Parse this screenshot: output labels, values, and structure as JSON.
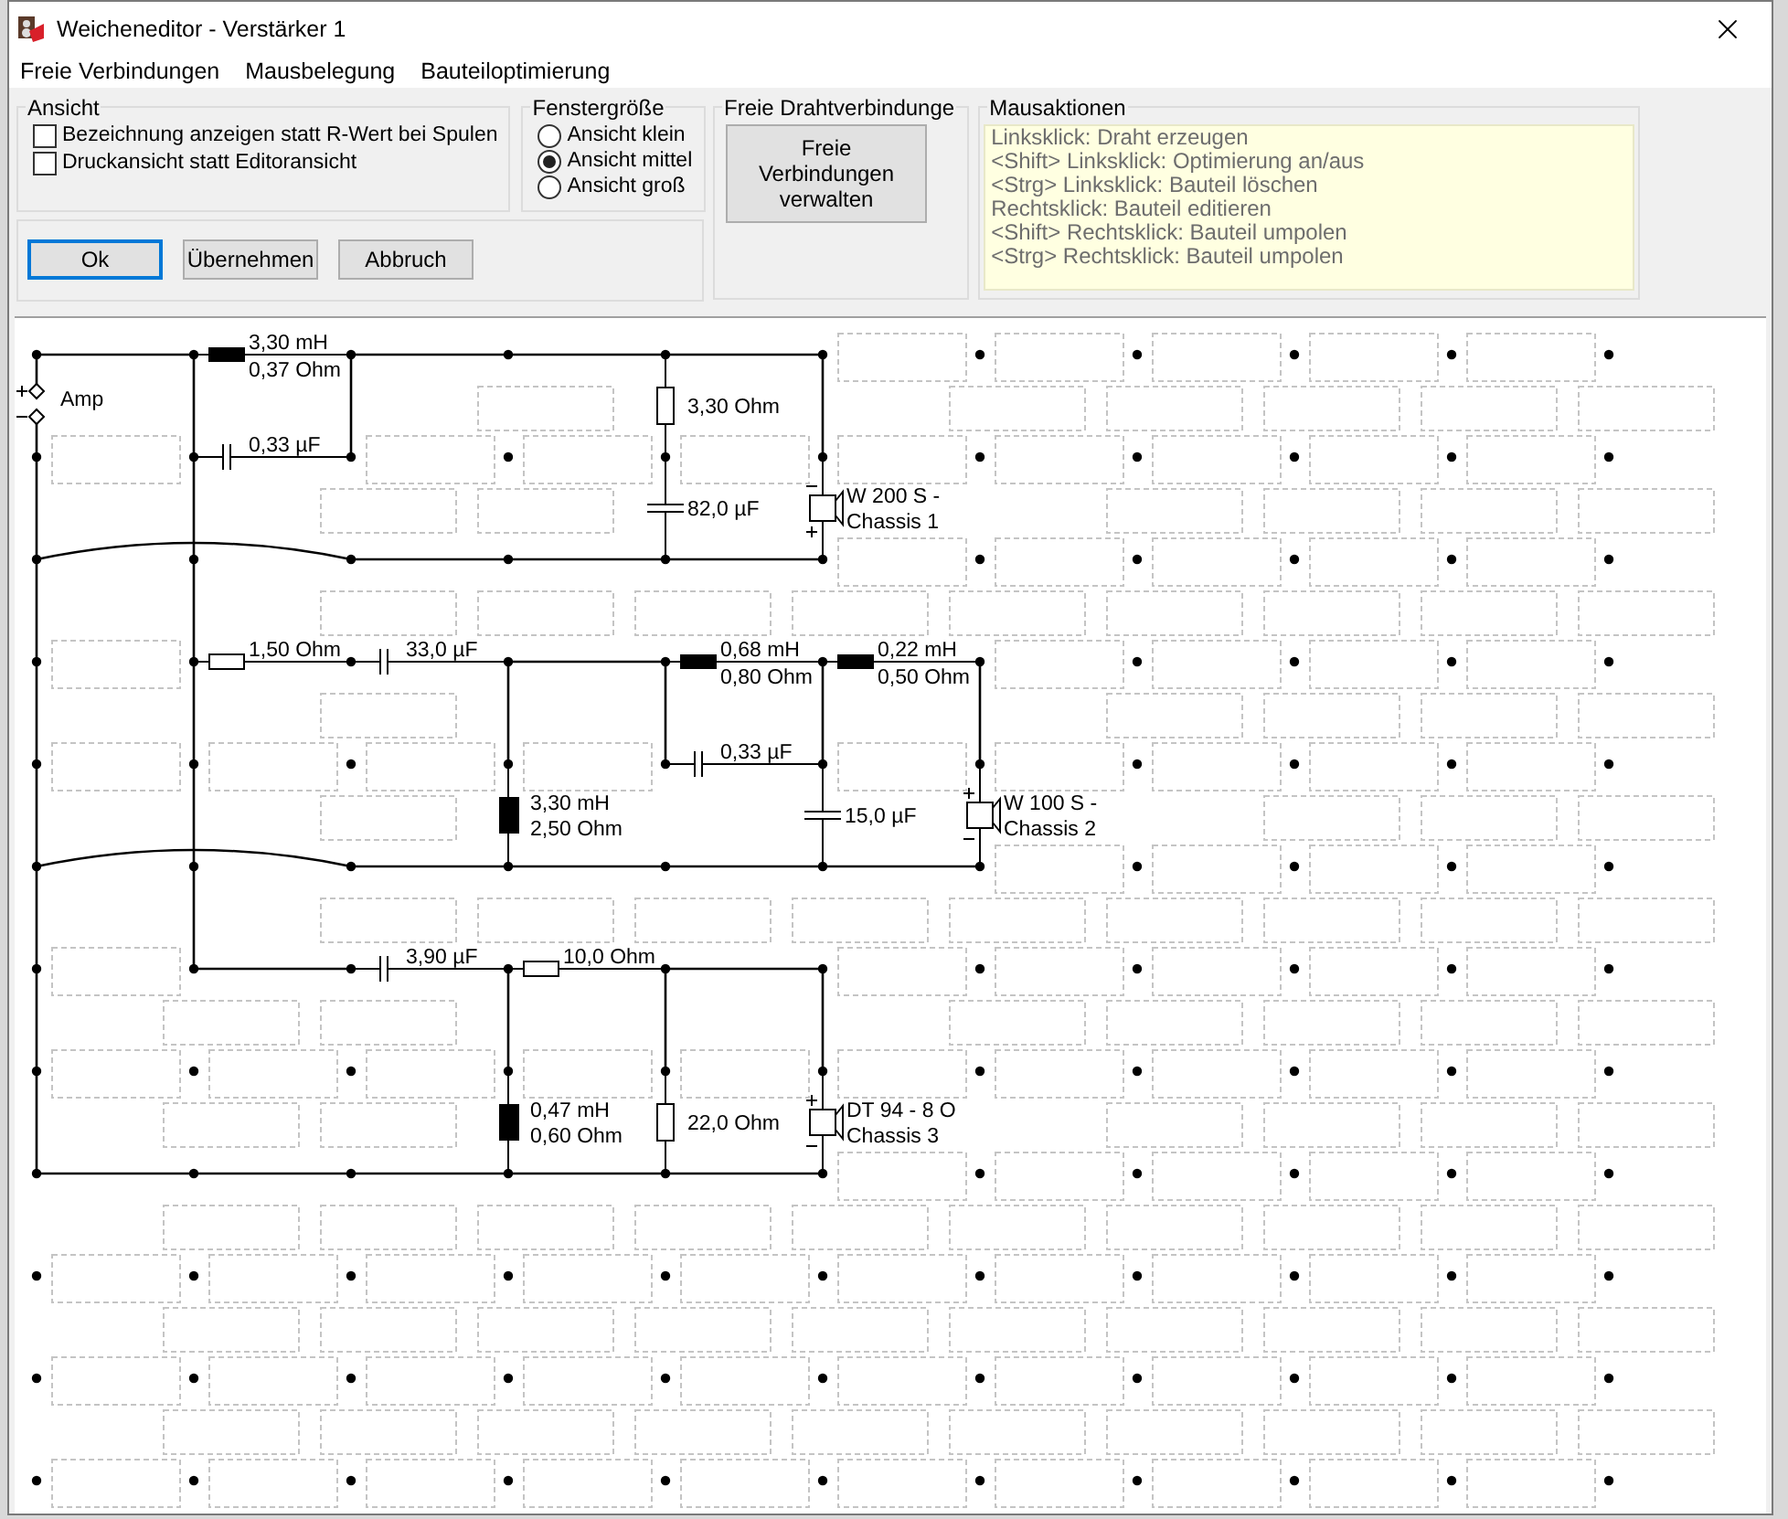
{
  "window": {
    "title": "Weicheneditor - Verstärker 1"
  },
  "menu": [
    "Freie Verbindungen",
    "Mausbelegung",
    "Bauteiloptimierung"
  ],
  "ansicht": {
    "title": "Ansicht",
    "options": [
      {
        "label": "Bezeichnung anzeigen statt R-Wert bei Spulen",
        "checked": false
      },
      {
        "label": "Druckansicht statt Editoransicht",
        "checked": false
      }
    ]
  },
  "fenstergroesse": {
    "title": "Fenstergröße",
    "options": [
      {
        "label": "Ansicht klein",
        "selected": false
      },
      {
        "label": "Ansicht mittel",
        "selected": true
      },
      {
        "label": "Ansicht groß",
        "selected": false
      }
    ]
  },
  "actions": [
    {
      "label": "Ok",
      "default": true
    },
    {
      "label": "Übernehmen",
      "default": false
    },
    {
      "label": "Abbruch",
      "default": false
    }
  ],
  "drahtverbindungen": {
    "title": "Freie Drahtverbindunge",
    "button": "Freie Verbindungen verwalten"
  },
  "mausaktionen": {
    "title": "Mausaktionen",
    "lines": [
      "Linksklick: Draht erzeugen",
      "<Shift> Linksklick: Optimierung an/aus",
      "<Strg> Linksklick: Bauteil löschen",
      "Rechtsklick: Bauteil editieren",
      "<Shift> Rechtsklick: Bauteil umpolen",
      "<Strg> Rechtsklick: Bauteil umpolen"
    ]
  },
  "schematic": {
    "amp": "Amp",
    "components": [
      {
        "kind": "inductor",
        "labels": [
          "3,30 mH",
          "0,37 Ohm"
        ]
      },
      {
        "kind": "capacitor",
        "labels": [
          "0,33 µF"
        ]
      },
      {
        "kind": "resistor",
        "labels": [
          "3,30 Ohm"
        ]
      },
      {
        "kind": "capacitor",
        "labels": [
          "82,0 µF"
        ]
      },
      {
        "kind": "speaker",
        "labels": [
          "W 200 S -",
          "Chassis 1"
        ],
        "inverted": true
      },
      {
        "kind": "resistor",
        "labels": [
          "1,50 Ohm"
        ]
      },
      {
        "kind": "capacitor",
        "labels": [
          "33,0 µF"
        ]
      },
      {
        "kind": "inductor",
        "labels": [
          "0,68 mH",
          "0,80 Ohm"
        ]
      },
      {
        "kind": "inductor",
        "labels": [
          "0,22 mH",
          "0,50 Ohm"
        ]
      },
      {
        "kind": "capacitor",
        "labels": [
          "0,33 µF"
        ]
      },
      {
        "kind": "inductor",
        "labels": [
          "3,30 mH",
          "2,50 Ohm"
        ]
      },
      {
        "kind": "capacitor",
        "labels": [
          "15,0 µF"
        ]
      },
      {
        "kind": "speaker",
        "labels": [
          "W 100 S -",
          "Chassis 2"
        ],
        "inverted": false
      },
      {
        "kind": "capacitor",
        "labels": [
          "3,90 µF"
        ]
      },
      {
        "kind": "resistor",
        "labels": [
          "10,0 Ohm"
        ]
      },
      {
        "kind": "inductor",
        "labels": [
          "0,47 mH",
          "0,60 Ohm"
        ]
      },
      {
        "kind": "resistor",
        "labels": [
          "22,0 Ohm"
        ]
      },
      {
        "kind": "speaker",
        "labels": [
          "DT 94 - 8 O",
          "Chassis 3"
        ],
        "inverted": false
      }
    ]
  }
}
